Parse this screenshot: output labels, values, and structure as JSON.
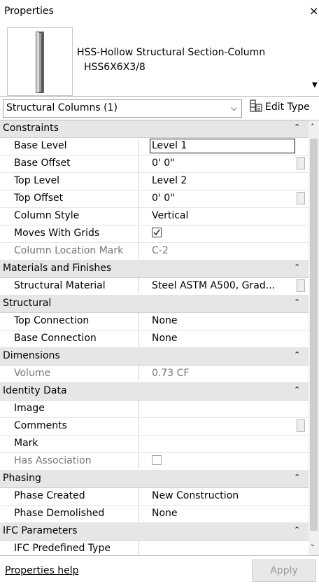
{
  "window": {
    "title": "Properties",
    "close_glyph": "×"
  },
  "type_selector": {
    "family": "HSS-Hollow Structural Section-Column",
    "type": "HSS6X6X3/8",
    "dropdown_icon": "caret-down-icon"
  },
  "filter": {
    "selected": "Structural Columns (1)",
    "chevron": "⌵"
  },
  "edit_type": {
    "label": "Edit Type",
    "icon": "edit-type-icon"
  },
  "groups": [
    {
      "name": "Constraints",
      "params": [
        {
          "name": "Base Level",
          "value": "Level 1",
          "editing": true
        },
        {
          "name": "Base Offset",
          "value": "0'  0\"",
          "button": true
        },
        {
          "name": "Top Level",
          "value": "Level 2"
        },
        {
          "name": "Top Offset",
          "value": "0'  0\"",
          "button": true
        },
        {
          "name": "Column Style",
          "value": "Vertical"
        },
        {
          "name": "Moves With Grids",
          "value": "",
          "checkbox": true,
          "checked": true
        },
        {
          "name": "Column Location Mark",
          "value": "C-2",
          "disabled": true
        }
      ]
    },
    {
      "name": "Materials and Finishes",
      "params": [
        {
          "name": "Structural Material",
          "value": "Steel ASTM A500, Grad...",
          "button": true
        }
      ]
    },
    {
      "name": "Structural",
      "params": [
        {
          "name": "Top Connection",
          "value": "None"
        },
        {
          "name": "Base Connection",
          "value": "None"
        }
      ]
    },
    {
      "name": "Dimensions",
      "params": [
        {
          "name": "Volume",
          "value": "0.73 CF",
          "disabled": true
        }
      ]
    },
    {
      "name": "Identity Data",
      "params": [
        {
          "name": "Image",
          "value": ""
        },
        {
          "name": "Comments",
          "value": "",
          "button": true
        },
        {
          "name": "Mark",
          "value": ""
        },
        {
          "name": "Has Association",
          "value": "",
          "checkbox": true,
          "checked": false,
          "disabled": true
        }
      ]
    },
    {
      "name": "Phasing",
      "params": [
        {
          "name": "Phase Created",
          "value": "New Construction"
        },
        {
          "name": "Phase Demolished",
          "value": "None"
        }
      ]
    },
    {
      "name": "IFC Parameters",
      "params": [
        {
          "name": "IFC Predefined Type",
          "value": ""
        }
      ]
    }
  ],
  "footer": {
    "help_link": "Properties help",
    "apply_label": "Apply",
    "apply_enabled": false
  },
  "colors": {
    "group_bg": "#e6e6e6",
    "disabled_text": "#777777",
    "apply_disabled_text": "#999999"
  }
}
